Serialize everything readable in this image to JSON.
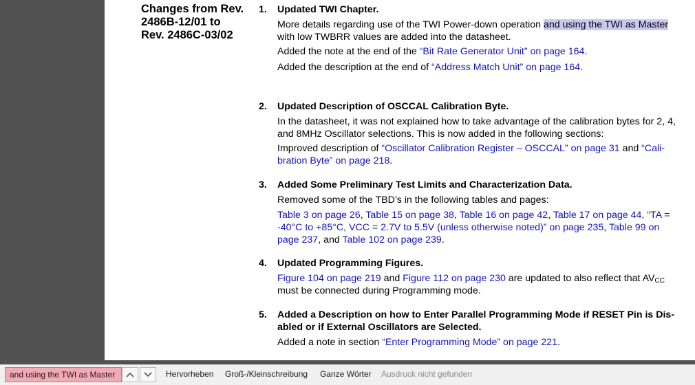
{
  "page": {
    "heading_lines": [
      "Changes from Rev.",
      "2486B-12/01 to",
      "Rev. 2486C-03/02"
    ],
    "items": [
      {
        "num": "1.",
        "title": "Updated TWI Chapter.",
        "p1_part1": "More details regarding use of the TWI Power-down operation ",
        "p1_highlight": "and using the TWI as Master",
        "p1_part2": "with low TWBRR values are added into the datasheet.",
        "p2_prefix": "Added the note at the end of the ",
        "p2_link": "“Bit Rate Generator Unit” on page 164",
        "p2_suffix": ".",
        "p3_prefix": "Added the description at the end of ",
        "p3_link": "“Address Match Unit” on page 164",
        "p3_suffix": "."
      },
      {
        "num": "2.",
        "title": "Updated Description of OSCCAL Calibration Byte.",
        "p1_line1": "In the datasheet, it was not explained how to take advantage of the calibration bytes for 2, 4,",
        "p1_line2": "and 8MHz Oscillator selections. This is now added in the following sections:",
        "p2_prefix": "Improved description of ",
        "p2_link1": "“Oscillator Calibration Register – OSCCAL” on page 31",
        "p2_and": " and ",
        "p2_link2a": "“Cali-",
        "p2_link2b": "bration Byte” on page 218",
        "p2_suffix": "."
      },
      {
        "num": "3.",
        "title": "Added Some Preliminary Test Limits and Characterization Data.",
        "p1": "Removed some of the TBD’s in the following tables and pages:",
        "l1_a": "Table 3 on page 26",
        "l1_b": "Table 15 on page 38",
        "l1_c": "Table 16 on page 42",
        "l1_d": "Table 17 on page 44",
        "l1_e": "“TA =",
        "l2_a": "-40°C to +85°C, VCC = 2.7V to 5.5V (unless otherwise noted)” on page 235",
        "l2_b": "Table 99 on",
        "l3_a": "page 237",
        "l3_and": ", and ",
        "l3_b": "Table 102 on page 239",
        "comma": ", ",
        "period": "."
      },
      {
        "num": "4.",
        "title": "Updated Programming Figures.",
        "link1": "Figure 104 on page 219",
        "and": " and ",
        "link2": "Figure 112 on page 230",
        "text1": " are updated to also reflect that AV",
        "sub": "CC",
        "line2": "must be connected during Programming mode."
      },
      {
        "num": "5.",
        "title_line1": "Added a Description on how to Enter Parallel Programming Mode if RESET Pin is Dis-",
        "title_line2": "abled or if External Oscillators are Selected.",
        "p_prefix": "Added a note in section ",
        "p_link": "“Enter Programming Mode” on page 221",
        "p_suffix": "."
      }
    ]
  },
  "findbar": {
    "query": "and using the TWI as Master",
    "up_icon": "chevron-up-icon",
    "down_icon": "chevron-down-icon",
    "highlight_all": "Hervorheben",
    "match_case": "Groß-/Kleinschreibung",
    "whole_words": "Ganze Wörter",
    "status": "Ausdruck nicht gefunden"
  },
  "colors": {
    "link": "#1414b8",
    "highlight": "#c8c8f0",
    "find_input_not_found": "#f2aab6",
    "viewer_background": "#525252"
  }
}
